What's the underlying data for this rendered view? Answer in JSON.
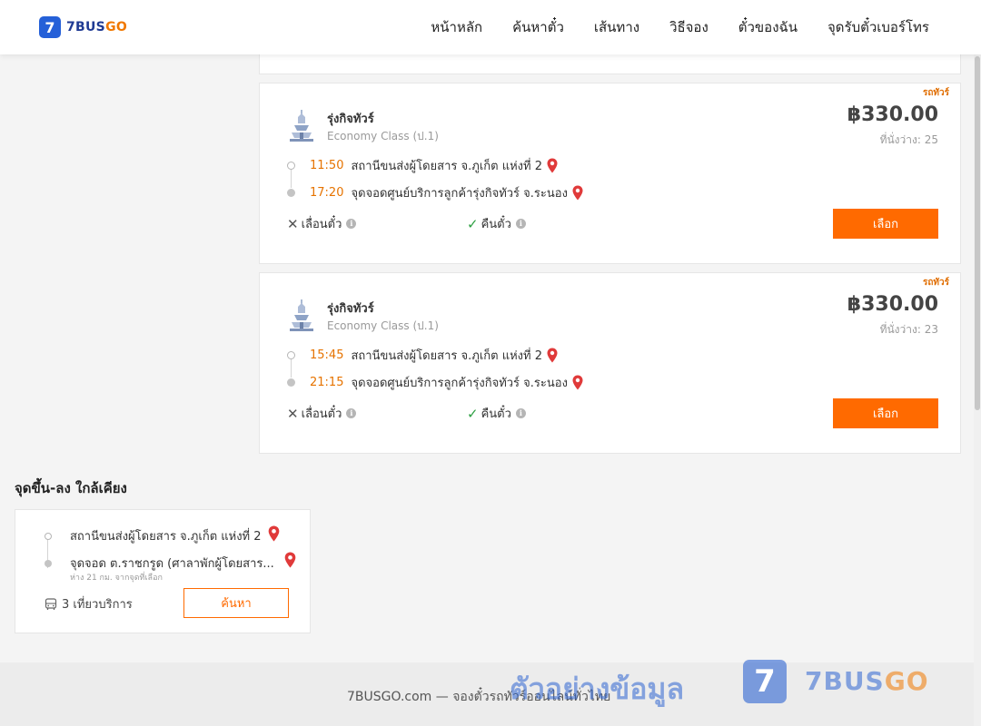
{
  "header": {
    "logo_mark": "7",
    "logo_text_main": "7BUS",
    "logo_text_accent": "GO",
    "nav": [
      "หน้าหลัก",
      "ค้นหาตั๋ว",
      "เส้นทาง",
      "วิธีจอง",
      "ตั๋วของฉัน",
      "จุดรับตั๋วเบอร์โทร"
    ]
  },
  "trips": [
    {
      "tag": "รถทัวร์",
      "operator": "รุ่งกิจทัวร์",
      "class": "Economy Class (ป.1)",
      "price": "฿330.00",
      "seats": "ที่นั่งว่าง: 25",
      "depart_time": "11:50",
      "depart_place": "สถานีขนส่งผู้โดยสาร จ.ภูเก็ต แห่งที่ 2",
      "arrive_time": "17:20",
      "arrive_place": "จุดจอดศูนย์บริการลูกค้ารุ่งกิจทัวร์ จ.ระนอง",
      "reschedule": "เลื่อนตั๋ว",
      "refund": "คืนตั๋ว",
      "select": "เลือก"
    },
    {
      "tag": "รถทัวร์",
      "operator": "รุ่งกิจทัวร์",
      "class": "Economy Class (ป.1)",
      "price": "฿330.00",
      "seats": "ที่นั่งว่าง: 23",
      "depart_time": "15:45",
      "depart_place": "สถานีขนส่งผู้โดยสาร จ.ภูเก็ต แห่งที่ 2",
      "arrive_time": "21:15",
      "arrive_place": "จุดจอดศูนย์บริการลูกค้ารุ่งกิจทัวร์ จ.ระนอง",
      "reschedule": "เลื่อนตั๋ว",
      "refund": "คืนตั๋ว",
      "select": "เลือก"
    }
  ],
  "nearby": {
    "title": "จุดขึ้น-ลง ใกล้เคียง",
    "from": "สถานีขนส่งผู้โดยสาร จ.ภูเก็ต แห่งที่ 2",
    "to": "จุดจอด ต.ราชกรูด (ศาลาพักผู้โดยสาร...",
    "distance": "ห่าง 21 กม. จากจุดที่เลือก",
    "trips": "3 เที่ยวบริการ",
    "search": "ค้นหา"
  },
  "footer": {
    "text": "7BUSGO.com — จองตั๋วรถทัวร์ออนไลน์ทั่วไทย",
    "watermark_text": "ตัวอย่างข้อมูล",
    "watermark_mark": "7",
    "watermark_brand_main": "7BUS",
    "watermark_brand_accent": "GO"
  },
  "icons": {
    "operator_logo": "temple-icon",
    "pin": "map-pin-icon",
    "info": "info-icon",
    "bus": "bus-icon",
    "close": "x-icon",
    "check": "check-icon"
  },
  "colors": {
    "accent": "#ff6a00",
    "time": "#e67300",
    "brand_blue": "#2560d8",
    "check_green": "#2ea043",
    "pin_red": "#e03a3a"
  }
}
